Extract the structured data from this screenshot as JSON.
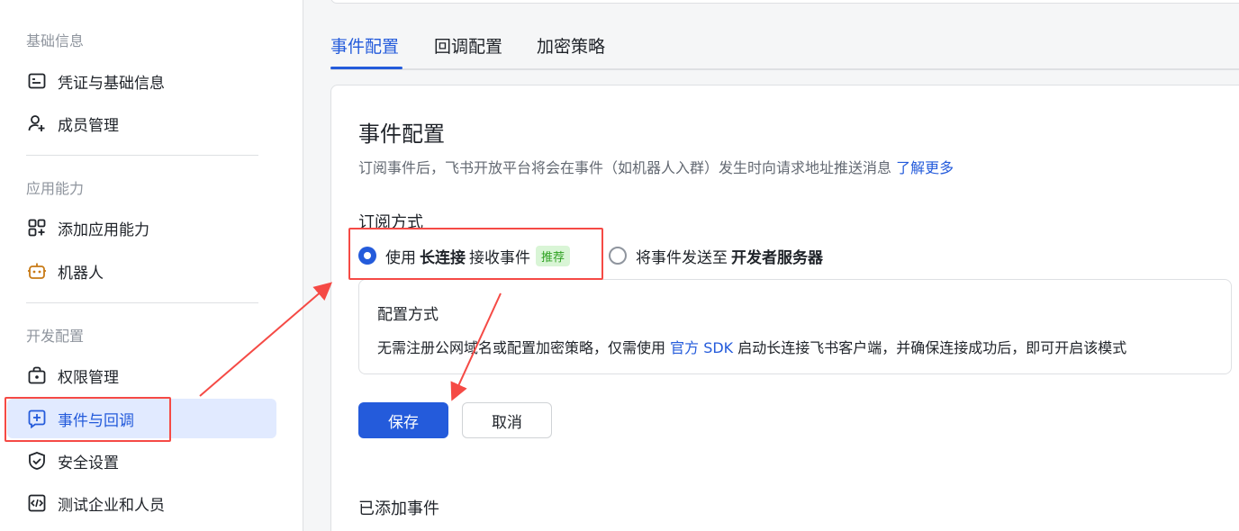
{
  "sidebar": {
    "sections": [
      {
        "title": "基础信息"
      },
      {
        "title": "应用能力"
      },
      {
        "title": "开发配置"
      }
    ],
    "items": [
      {
        "label": "凭证与基础信息",
        "icon": "credential-icon"
      },
      {
        "label": "成员管理",
        "icon": "member-add-icon"
      },
      {
        "label": "添加应用能力",
        "icon": "app-grid-add-icon"
      },
      {
        "label": "机器人",
        "icon": "robot-icon"
      },
      {
        "label": "权限管理",
        "icon": "permission-icon"
      },
      {
        "label": "事件与回调",
        "icon": "event-callback-icon",
        "active": true
      },
      {
        "label": "安全设置",
        "icon": "shield-check-icon"
      },
      {
        "label": "测试企业和人员",
        "icon": "code-window-icon"
      }
    ]
  },
  "tabs": [
    {
      "label": "事件配置",
      "active": true
    },
    {
      "label": "回调配置"
    },
    {
      "label": "加密策略"
    }
  ],
  "card": {
    "title": "事件配置",
    "desc": "订阅事件后，飞书开放平台将会在事件（如机器人入群）发生时向请求地址推送消息",
    "desc_link": "了解更多",
    "subscribe_title": "订阅方式",
    "option1": {
      "prefix": "使用",
      "bold": "长连接",
      "suffix": "接收事件",
      "tag": "推荐",
      "checked": true
    },
    "option2": {
      "prefix": "将事件发送至",
      "bold": "开发者服务器",
      "checked": false
    },
    "config": {
      "title": "配置方式",
      "text_before": "无需注册公网域名或配置加密策略，仅需使用",
      "link": "官方 SDK",
      "text_after": "启动长连接飞书客户端，并确保连接成功后，即可开启该模式"
    },
    "save_label": "保存",
    "cancel_label": "取消",
    "added_title": "已添加事件"
  },
  "colors": {
    "accent": "#245bdb",
    "annotation": "#f54a45",
    "active_bg": "#e1eaff",
    "tag_green": "#2ea121"
  }
}
